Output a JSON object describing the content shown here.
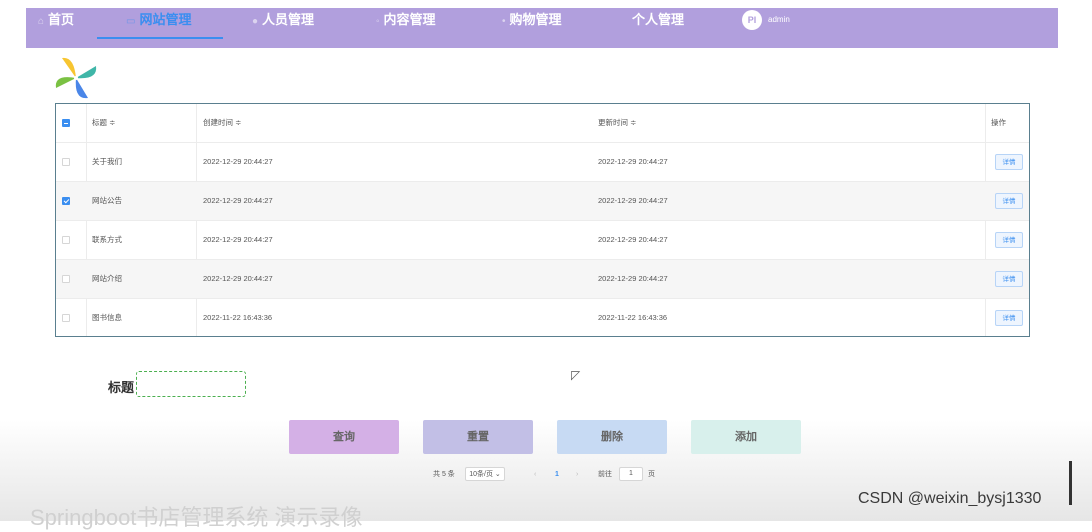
{
  "nav": {
    "items": [
      {
        "label": "首页",
        "icon": "home-icon"
      },
      {
        "label": "网站管理",
        "icon": "monitor-icon",
        "active": true
      },
      {
        "label": "人员管理",
        "icon": "user-icon"
      },
      {
        "label": "内容管理",
        "icon": "content-icon"
      },
      {
        "label": "购物管理",
        "icon": "cart-icon"
      },
      {
        "label": "个人管理",
        "icon": ""
      }
    ],
    "avatar_text": "PI",
    "user": "admin"
  },
  "table": {
    "headers": {
      "title": "标题 ≑",
      "created": "创建时间 ≑",
      "updated": "更新时间 ≑",
      "action": "操作"
    },
    "rows": [
      {
        "title": "关于我们",
        "created": "2022-12-29 20:44:27",
        "updated": "2022-12-29 20:44:27",
        "checked": false,
        "btn": "详情"
      },
      {
        "title": "网站公告",
        "created": "2022-12-29 20:44:27",
        "updated": "2022-12-29 20:44:27",
        "checked": true,
        "btn": "详情"
      },
      {
        "title": "联系方式",
        "created": "2022-12-29 20:44:27",
        "updated": "2022-12-29 20:44:27",
        "checked": false,
        "btn": "详情"
      },
      {
        "title": "网站介绍",
        "created": "2022-12-29 20:44:27",
        "updated": "2022-12-29 20:44:27",
        "checked": false,
        "btn": "详情"
      },
      {
        "title": "图书信息",
        "created": "2022-11-22 16:43:36",
        "updated": "2022-11-22 16:43:36",
        "checked": false,
        "btn": "详情"
      }
    ]
  },
  "search": {
    "label": "标题",
    "value": ""
  },
  "buttons": {
    "query": "查询",
    "reset": "重置",
    "delete": "删除",
    "add": "添加"
  },
  "colors": {
    "nav": "#b19fdd",
    "accent": "#3a8ef0",
    "query": "#d4b0e6",
    "reset": "#c2bfe6",
    "delete": "#c7daf3",
    "add": "#d8f0ec"
  },
  "pager": {
    "total": "共 5 条",
    "page_size": "10条/页",
    "prev": "‹",
    "current": "1",
    "next": "›",
    "goto": "前往",
    "goto_value": "1",
    "page_unit": "页"
  },
  "footer_ghost": "Springboot书店管理系统 演示录像",
  "watermark": "CSDN @weixin_bysj1330"
}
